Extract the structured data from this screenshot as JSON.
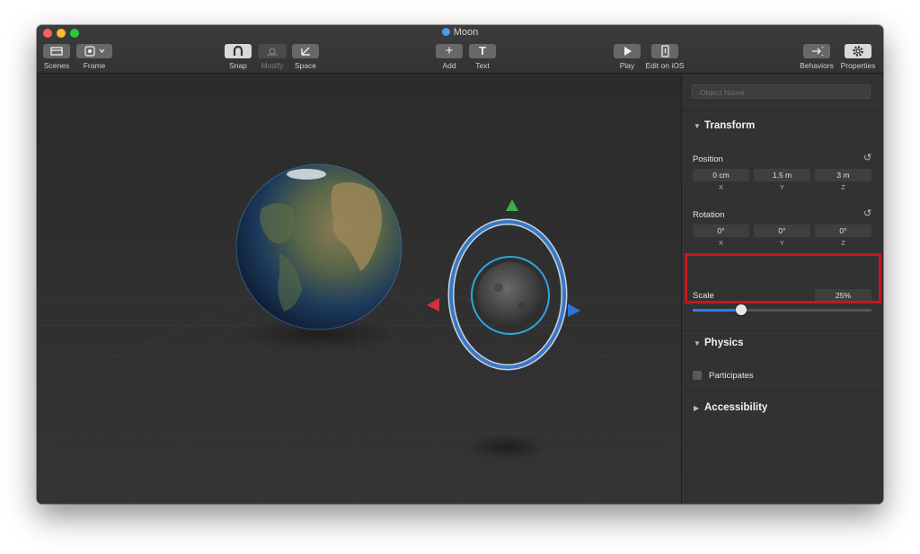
{
  "window": {
    "title": "Moon",
    "title_icon": "scene-object-icon"
  },
  "toolbar": {
    "scenes_label": "Scenes",
    "frame_label": "Frame",
    "snap_label": "Snap",
    "modify_label": "Modify",
    "space_label": "Space",
    "add_label": "Add",
    "text_label": "Text",
    "play_label": "Play",
    "edit_ios_label": "Edit on iOS",
    "behaviors_label": "Behaviors",
    "properties_label": "Properties",
    "text_glyph": "T",
    "add_glyph": "+"
  },
  "inspector": {
    "object_name_placeholder": "Object Name",
    "transform_title": "Transform",
    "position": {
      "label": "Position",
      "x": "0 cm",
      "y": "1.5 m",
      "z": "3 m",
      "x_axis": "X",
      "y_axis": "Y",
      "z_axis": "Z"
    },
    "rotation": {
      "label": "Rotation",
      "x": "0°",
      "y": "0°",
      "z": "0°",
      "x_axis": "X",
      "y_axis": "Y",
      "z_axis": "Z"
    },
    "scale": {
      "label": "Scale",
      "value_text": "25%",
      "slider_fraction": 0.27
    },
    "physics_title": "Physics",
    "participates_label": "Participates",
    "participates_checked": false,
    "accessibility_title": "Accessibility"
  },
  "colors": {
    "accent": "#2f7bf6",
    "highlight": "#c8161b",
    "gizmo_ring": "#3b78c4",
    "gizmo_up": "#3fae47",
    "gizmo_left": "#d2323e",
    "gizmo_right": "#2f72d8"
  }
}
